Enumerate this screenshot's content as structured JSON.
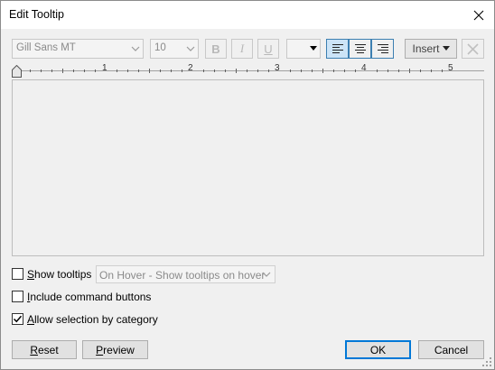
{
  "window": {
    "title": "Edit Tooltip"
  },
  "toolbar": {
    "font_family": "Gill Sans MT",
    "font_size": "10",
    "bold_label": "B",
    "italic_label": "I",
    "underline_label": "U",
    "insert_label": "Insert",
    "align_active": "left"
  },
  "ruler": {
    "marks": [
      "1",
      "2",
      "3",
      "4",
      "5"
    ]
  },
  "options": {
    "show_tooltips": {
      "label_prefix": "S",
      "label_rest": "how tooltips",
      "checked": false
    },
    "tooltip_mode": "On Hover - Show tooltips on hover",
    "include_buttons": {
      "label_prefix": "I",
      "label_rest": "nclude command buttons",
      "checked": false
    },
    "allow_selection": {
      "label_prefix": "A",
      "label_rest": "llow selection by category",
      "checked": true
    }
  },
  "buttons": {
    "reset_prefix": "R",
    "reset_rest": "eset",
    "preview_prefix": "P",
    "preview_rest": "review",
    "ok": "OK",
    "cancel": "Cancel"
  },
  "colors": {
    "accent": "#0078d7",
    "active_fill": "#cce4f7"
  }
}
